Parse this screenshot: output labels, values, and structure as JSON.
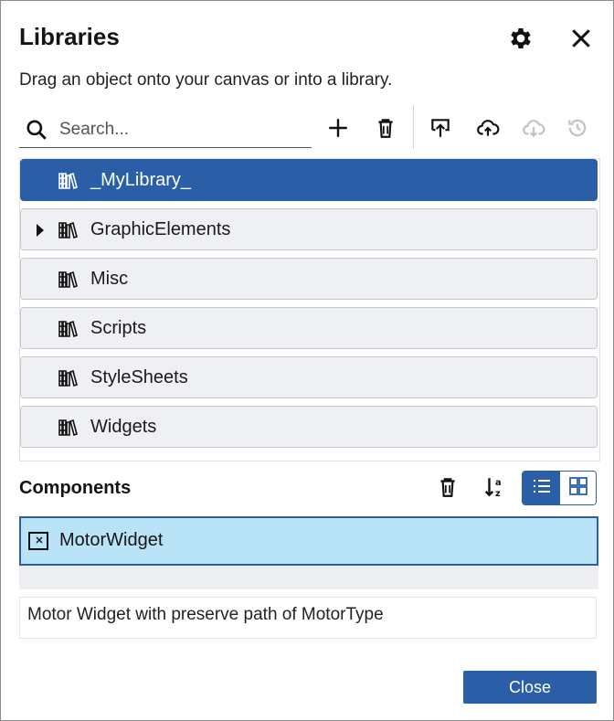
{
  "dialog": {
    "title": "Libraries",
    "subtitle": "Drag an object onto your canvas or into a library."
  },
  "search": {
    "placeholder": "Search..."
  },
  "toolbar": {
    "icons": [
      "plus-icon",
      "trash-icon",
      "import-icon",
      "upload-cloud-icon",
      "download-cloud-icon",
      "history-icon"
    ]
  },
  "libraries": [
    {
      "label": "_MyLibrary_",
      "selected": true,
      "expandable": false
    },
    {
      "label": "GraphicElements",
      "selected": false,
      "expandable": true
    },
    {
      "label": "Misc",
      "selected": false,
      "expandable": false
    },
    {
      "label": "Scripts",
      "selected": false,
      "expandable": false
    },
    {
      "label": "StyleSheets",
      "selected": false,
      "expandable": false
    },
    {
      "label": "Widgets",
      "selected": false,
      "expandable": false
    }
  ],
  "components": {
    "title": "Components",
    "items": [
      {
        "label": "MotorWidget",
        "selected": true
      }
    ],
    "description": "Motor Widget with preserve path of MotorType",
    "view_mode": "list"
  },
  "footer": {
    "close_label": "Close"
  },
  "colors": {
    "accent": "#2a5fa8",
    "selected_component_bg": "#b9e3f7",
    "list_item_bg": "#eef0f3"
  }
}
